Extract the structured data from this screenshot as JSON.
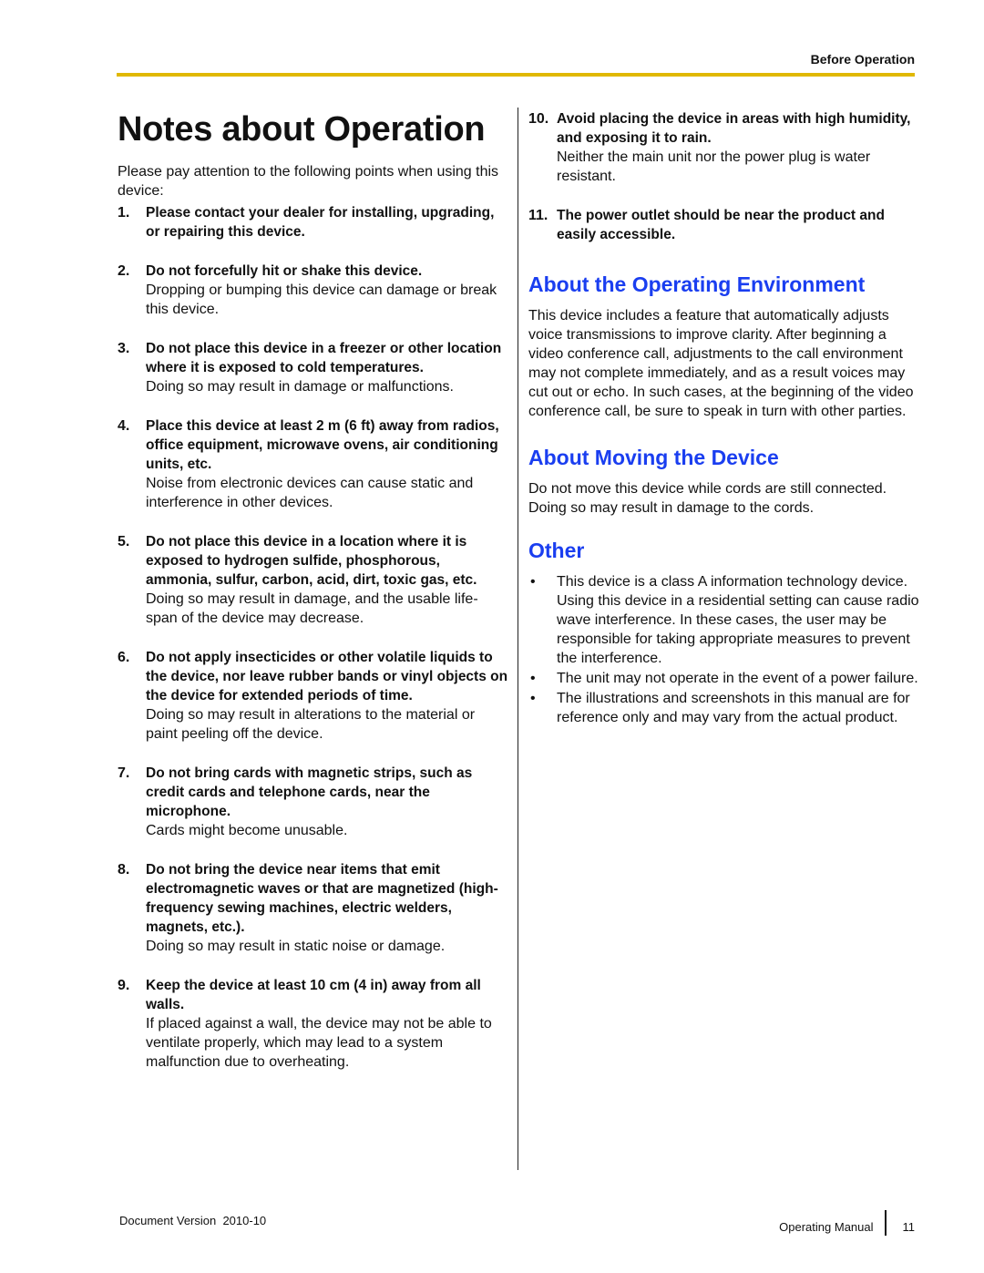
{
  "header": {
    "section_label": "Before Operation",
    "rule_color": "#e0b800"
  },
  "title": "Notes about Operation",
  "intro": "Please pay attention to the following points when using this device:",
  "notes": [
    {
      "num": "1.",
      "head": "Please contact your dealer for installing, upgrading, or repairing this device.",
      "desc": ""
    },
    {
      "num": "2.",
      "head": "Do not forcefully hit or shake this device.",
      "desc": "Dropping or bumping this device can damage or break this device."
    },
    {
      "num": "3.",
      "head": "Do not place this device in a freezer or other location where it is exposed to cold temperatures.",
      "desc": "Doing so may result in damage or malfunctions."
    },
    {
      "num": "4.",
      "head": "Place this device at least 2 m (6 ft) away from radios, office equipment, microwave ovens, air conditioning units, etc.",
      "desc": "Noise from electronic devices can cause static and interference in other devices."
    },
    {
      "num": "5.",
      "head": "Do not place this device in a location where it is exposed to hydrogen sulfide, phosphorous, ammonia, sulfur, carbon, acid, dirt, toxic gas, etc.",
      "desc": "Doing so may result in damage, and the usable life-span of the device may decrease."
    },
    {
      "num": "6.",
      "head": "Do not apply insecticides or other volatile liquids to the device, nor leave rubber bands or vinyl objects on the device for extended periods of time.",
      "desc": "Doing so may result in alterations to the material or paint peeling off the device."
    },
    {
      "num": "7.",
      "head": "Do not bring cards with magnetic strips, such as credit cards and telephone cards, near the microphone.",
      "desc": "Cards might become unusable."
    },
    {
      "num": "8.",
      "head": "Do not bring the device near items that emit electromagnetic waves or that are magnetized (high-frequency sewing machines, electric welders, magnets, etc.).",
      "desc": "Doing so may result in static noise or damage."
    },
    {
      "num": "9.",
      "head": "Keep the device at least 10 cm (4 in) away from all walls.",
      "desc": "If placed against a wall, the device may not be able to ventilate properly, which may lead to a system malfunction due to overheating."
    },
    {
      "num": "10.",
      "head": "Avoid placing the device in areas with high humidity, and exposing it to rain.",
      "desc": "Neither the main unit nor the power plug is water resistant."
    },
    {
      "num": "11.",
      "head": "The power outlet should be near the product and easily accessible.",
      "desc": ""
    }
  ],
  "sections": {
    "environment": {
      "heading": "About the Operating Environment",
      "text": "This device includes a feature that automatically adjusts voice transmissions to improve clarity. After beginning a video conference call, adjustments to the call environment may not complete immediately, and as a result voices may cut out or echo. In such cases, at the beginning of the video conference call, be sure to speak in turn with other parties."
    },
    "moving": {
      "heading": "About Moving the Device",
      "text": "Do not move this device while cords are still connected. Doing so may result in damage to the cords."
    },
    "other": {
      "heading": "Other",
      "bullets": [
        "This device is a class A information technology device. Using this device in a residential setting can cause radio wave interference. In these cases, the user may be responsible for taking appropriate measures to prevent the interference.",
        "The unit may not operate in the event of a power failure.",
        "The illustrations and screenshots in this manual are for reference only and may vary from the actual product."
      ],
      "bullet_glyph": "•"
    }
  },
  "heading_color": "#1a3ef0",
  "footer": {
    "doc_version_label": "Document Version  2010-10",
    "manual_label": "Operating Manual",
    "page_number": "11"
  }
}
